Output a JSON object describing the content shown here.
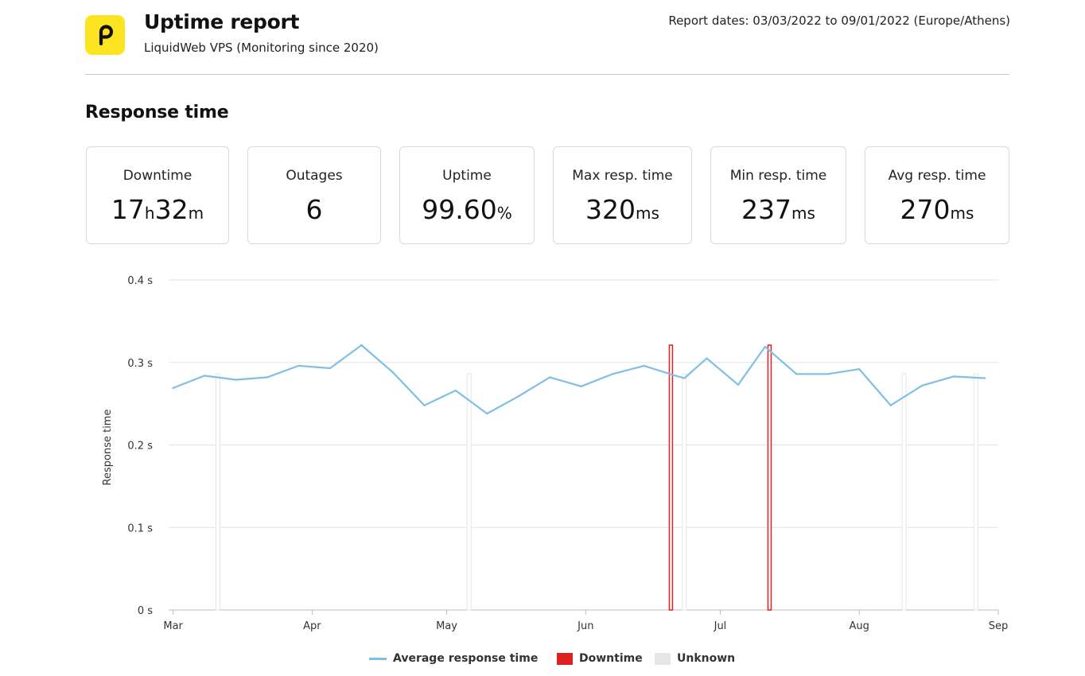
{
  "header": {
    "title": "Uptime report",
    "subtitle": "LiquidWeb VPS (Monitoring since 2020)",
    "report_dates": "Report dates: 03/03/2022 to 09/01/2022 (Europe/Athens)",
    "logo_icon": "p-logo-icon",
    "logo_color": "#fde423"
  },
  "section_title": "Response time",
  "stats": [
    {
      "label": "Downtime",
      "value": "17",
      "unit": "h",
      "value2": "32",
      "unit2": "m"
    },
    {
      "label": "Outages",
      "value": "6",
      "unit": "",
      "value2": "",
      "unit2": ""
    },
    {
      "label": "Uptime",
      "value": "99.60",
      "unit": "%",
      "value2": "",
      "unit2": ""
    },
    {
      "label": "Max resp. time",
      "value": "320",
      "unit": "ms",
      "value2": "",
      "unit2": ""
    },
    {
      "label": "Min resp. time",
      "value": "237",
      "unit": "ms",
      "value2": "",
      "unit2": ""
    },
    {
      "label": "Avg resp. time",
      "value": "270",
      "unit": "ms",
      "value2": "",
      "unit2": ""
    }
  ],
  "chart_data": {
    "type": "line",
    "ylabel": "Response time",
    "ylim": [
      0,
      0.4
    ],
    "yticks": [
      0,
      0.1,
      0.2,
      0.3,
      0.4
    ],
    "ytick_labels": [
      "0 s",
      "0.1 s",
      "0.2 s",
      "0.3 s",
      "0.4 s"
    ],
    "xlim": [
      "2022-02-28",
      "2022-09-01"
    ],
    "xticks": [
      "2022-03-01",
      "2022-04-01",
      "2022-05-01",
      "2022-06-01",
      "2022-07-01",
      "2022-08-01",
      "2022-09-01"
    ],
    "xtick_labels": [
      "Mar",
      "Apr",
      "May",
      "Jun",
      "Jul",
      "Aug",
      "Sep"
    ],
    "grid": true,
    "legend_position": "bottom",
    "series": [
      {
        "name": "Average response time",
        "color": "#7fbfe5",
        "x": [
          "2022-03-01",
          "2022-03-08",
          "2022-03-15",
          "2022-03-22",
          "2022-03-29",
          "2022-04-05",
          "2022-04-12",
          "2022-04-19",
          "2022-04-26",
          "2022-05-03",
          "2022-05-10",
          "2022-05-17",
          "2022-05-24",
          "2022-05-31",
          "2022-06-07",
          "2022-06-14",
          "2022-06-21",
          "2022-06-23",
          "2022-06-28",
          "2022-07-05",
          "2022-07-11",
          "2022-07-18",
          "2022-07-25",
          "2022-08-01",
          "2022-08-08",
          "2022-08-15",
          "2022-08-22",
          "2022-08-29"
        ],
        "values": [
          0.269,
          0.284,
          0.279,
          0.282,
          0.296,
          0.293,
          0.321,
          0.288,
          0.248,
          0.266,
          0.238,
          0.259,
          0.282,
          0.271,
          0.286,
          0.296,
          0.284,
          0.281,
          0.305,
          0.273,
          0.319,
          0.286,
          0.286,
          0.292,
          0.248,
          0.272,
          0.283,
          0.281
        ]
      }
    ],
    "downtime": {
      "name": "Downtime",
      "color": "#dd2020",
      "dates": [
        "2022-06-20",
        "2022-07-12"
      ]
    },
    "unknown": {
      "name": "Unknown",
      "color": "#e6e6e6",
      "dates": [
        "2022-03-11",
        "2022-05-06",
        "2022-06-23",
        "2022-08-11",
        "2022-08-27"
      ]
    }
  }
}
